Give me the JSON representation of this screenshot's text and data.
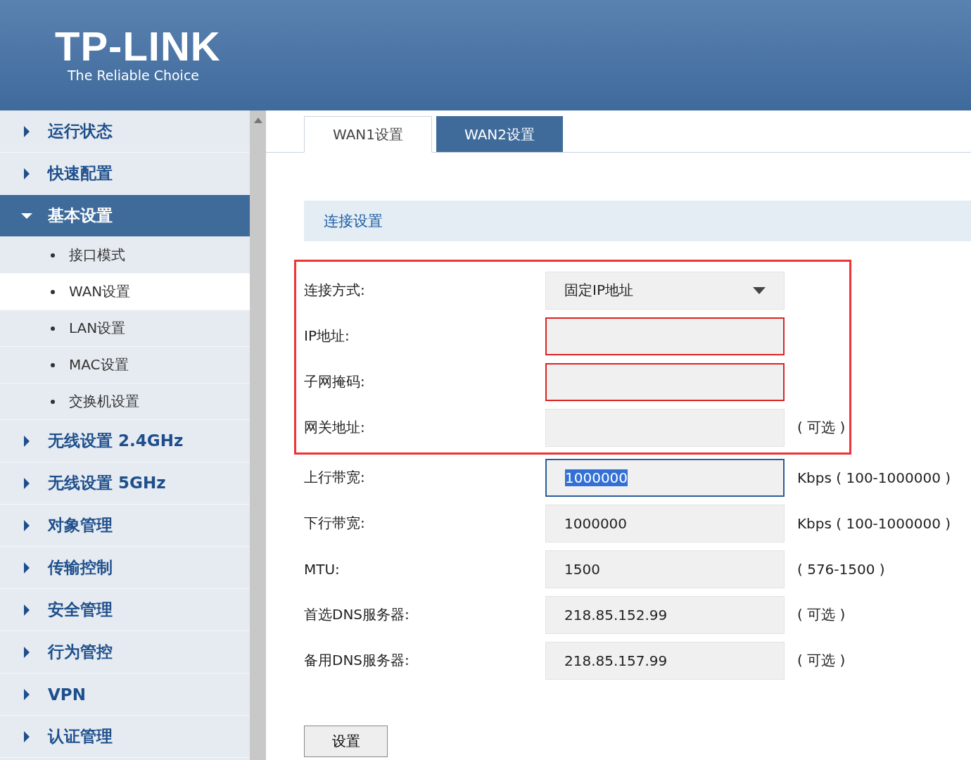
{
  "header": {
    "logo": "TP-LINK",
    "tagline": "The Reliable Choice"
  },
  "sidebar": {
    "items": [
      {
        "label": "运行状态",
        "expanded": false
      },
      {
        "label": "快速配置",
        "expanded": false
      },
      {
        "label": "基本设置",
        "expanded": true,
        "children": [
          {
            "label": "接口模式",
            "selected": false
          },
          {
            "label": "WAN设置",
            "selected": true
          },
          {
            "label": "LAN设置",
            "selected": false
          },
          {
            "label": "MAC设置",
            "selected": false
          },
          {
            "label": "交换机设置",
            "selected": false
          }
        ]
      },
      {
        "label": "无线设置 2.4GHz",
        "expanded": false
      },
      {
        "label": "无线设置 5GHz",
        "expanded": false
      },
      {
        "label": "对象管理",
        "expanded": false
      },
      {
        "label": "传输控制",
        "expanded": false
      },
      {
        "label": "安全管理",
        "expanded": false
      },
      {
        "label": "行为管控",
        "expanded": false
      },
      {
        "label": "VPN",
        "expanded": false
      },
      {
        "label": "认证管理",
        "expanded": false
      }
    ]
  },
  "tabs": [
    {
      "label": "WAN1设置",
      "selected": true
    },
    {
      "label": "WAN2设置",
      "selected": false
    }
  ],
  "section_title": "连接设置",
  "fields": [
    {
      "label": "连接方式:",
      "kind": "select",
      "value": "固定IP地址",
      "highlighted": true
    },
    {
      "label": "IP地址:",
      "kind": "input",
      "invalid": true,
      "highlighted": true
    },
    {
      "label": "子网掩码:",
      "kind": "input",
      "invalid": true,
      "highlighted": true
    },
    {
      "label": "网关地址:",
      "kind": "input",
      "hint": "( 可选 )",
      "highlighted": true
    },
    {
      "label": "上行带宽:",
      "kind": "input",
      "value": "1000000",
      "focused": true,
      "hint": "Kbps ( 100-1000000 )"
    },
    {
      "label": "下行带宽:",
      "kind": "input",
      "value": "1000000",
      "hint": "Kbps ( 100-1000000 )"
    },
    {
      "label": "MTU:",
      "kind": "input",
      "value": "1500",
      "hint": "( 576-1500 )"
    },
    {
      "label": "首选DNS服务器:",
      "kind": "input",
      "value": "218.85.152.99",
      "hint": "( 可选 )"
    },
    {
      "label": "备用DNS服务器:",
      "kind": "input",
      "value": "218.85.157.99",
      "hint": "( 可选 )"
    }
  ],
  "submit": "设置"
}
